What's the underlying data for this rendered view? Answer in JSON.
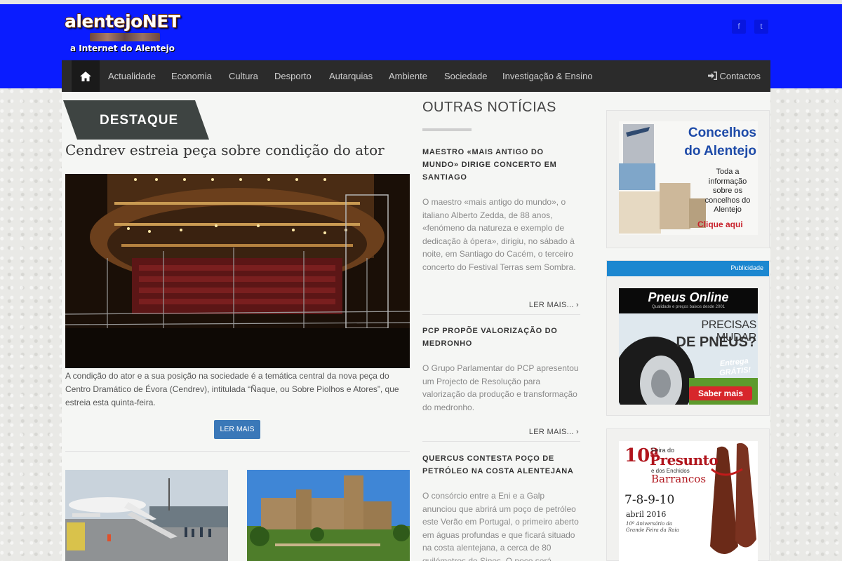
{
  "brand": {
    "name": "alentejoNET",
    "tagline": "a Internet do Alentejo"
  },
  "social": {
    "facebook_glyph": "f",
    "twitter_glyph": "t"
  },
  "nav": {
    "items": [
      "Actualidade",
      "Economia",
      "Cultura",
      "Desporto",
      "Autarquias",
      "Ambiente",
      "Sociedade",
      "Investigação & Ensino"
    ],
    "contact_label": "Contactos"
  },
  "featured": {
    "section_label": "DESTAQUE",
    "headline": "Cendrev estreia peça sobre condição do ator",
    "summary": "A condição do ator e a sua posição na sociedade é a temática central da nova peça do Centro Dramático de Évora (Cendrev), intitulada “Ñaque, ou Sobre Piolhos e Atores”, que estreia esta quinta-feira.",
    "read_more": "LER MAIS"
  },
  "other_news": {
    "title": "OUTRAS NOTÍCIAS",
    "read_more": "LER MAIS... ›",
    "items": [
      {
        "title": "Maestro «mais antigo do mundo» dirige concerto em Santiago",
        "body": "O maestro «mais antigo do mundo», o italiano Alberto Zedda, de 88 anos, «fenómeno da natureza e exemplo de dedicação à ópera», dirigiu, no sábado à noite, em Santiago do Cacém, o terceiro concerto do Festival Terras sem Sombra."
      },
      {
        "title": "PCP propõe valorização do medronho",
        "body": "O Grupo Parlamentar do PCP apresentou um Projecto de Resolução para valorização da produção e transformação do medronho."
      },
      {
        "title": "Quercus contesta poço de petróleo na costa alentejana",
        "body": "O consórcio entre a Eni e a Galp anunciou que abrirá um poço de petróleo este Verão em Portugal, o primeiro aberto em águas profundas e que ficará situado na costa alentejana, a cerca de 80 quilómetros de Sines. O poço será"
      }
    ]
  },
  "sidebar": {
    "ad1": {
      "title_line1": "Concelhos",
      "title_line2": "do Alentejo",
      "text": "Toda a informação sobre os concelhos do Alentejo",
      "cta": "Clique aqui"
    },
    "ad2": {
      "pub_label": "Publicidade",
      "brand": "Pneus Online",
      "brand_sub": "Qualidade e preços baixos desde 2001",
      "headline_1": "PRECISAS MUDAR",
      "headline_2": "DE PNEUS?",
      "badge_1": "Entrega",
      "badge_2": "GRÁTIS!",
      "cta": "Saber mais"
    },
    "ad3": {
      "number": "10ª",
      "pre": "Feira do",
      "title": "Presunto",
      "sub": "e dos Enchidos",
      "town": "Barrancos",
      "dates": "7-8-9-10",
      "month": "abril 2016",
      "note_1": "10º Aniversário da",
      "note_2": "Grande Feira da Raia"
    }
  }
}
